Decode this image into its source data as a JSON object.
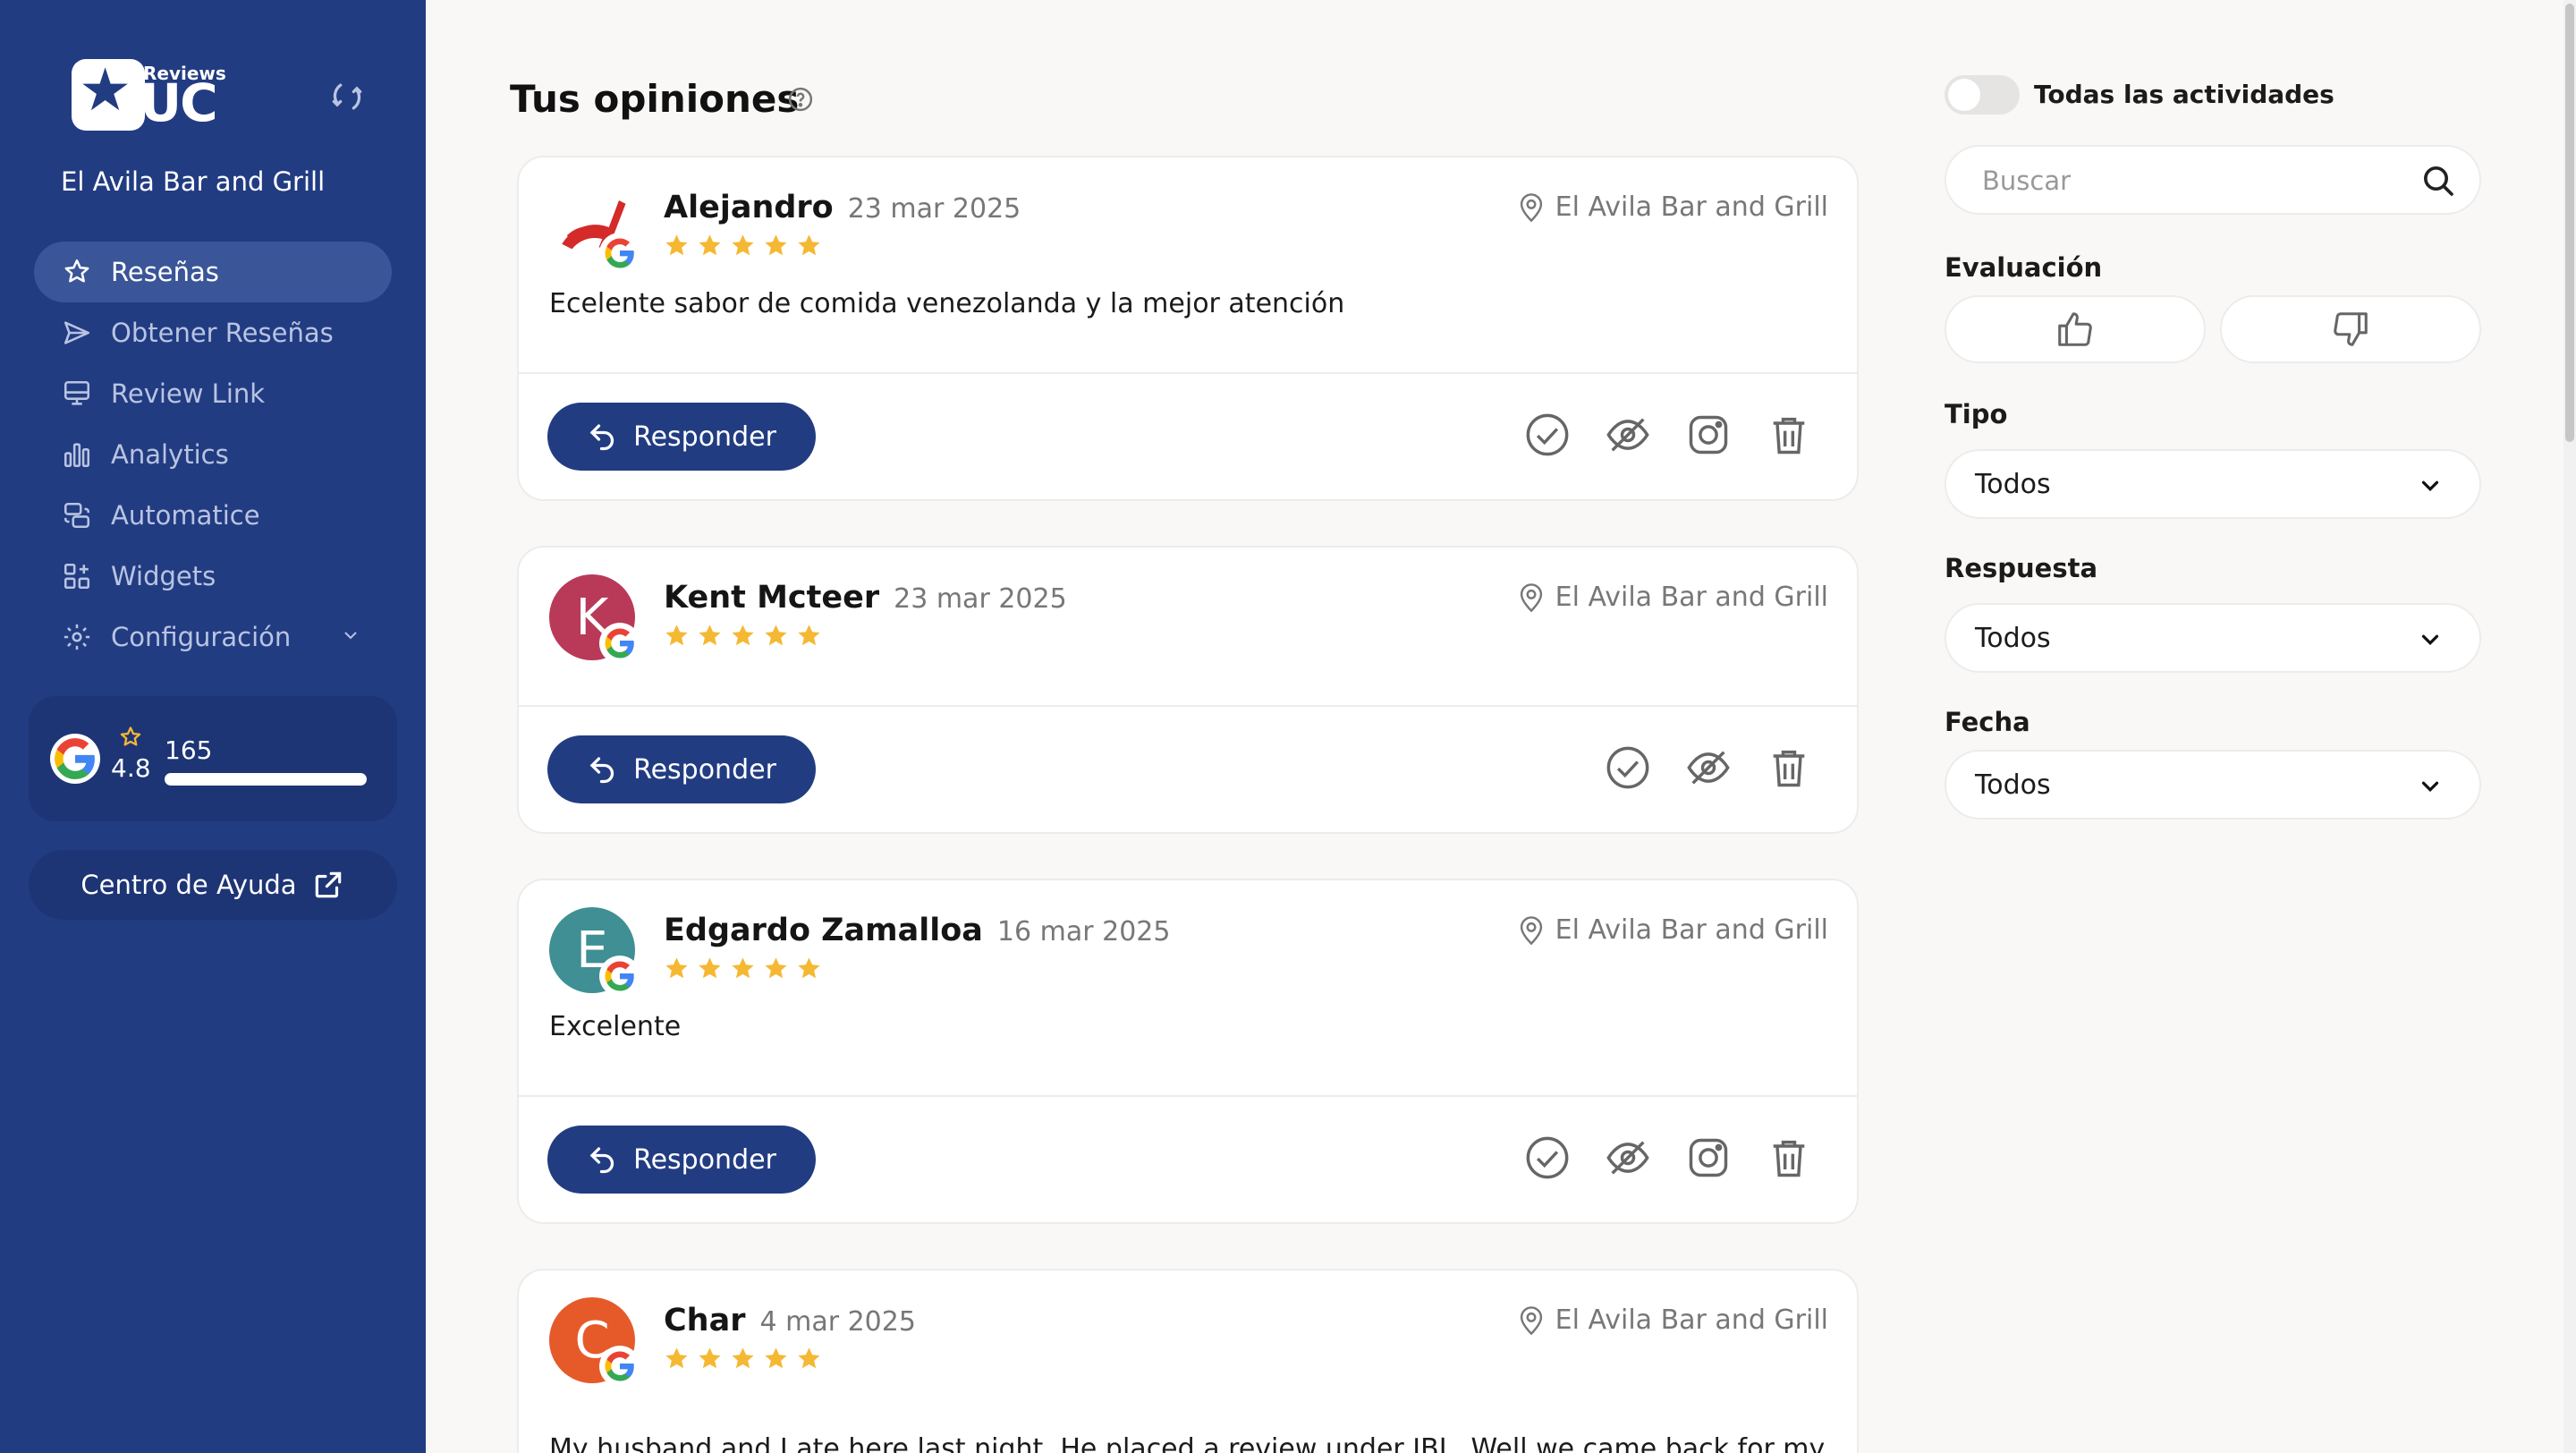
{
  "app": {
    "logo_small": "Reviews",
    "logo_big": "UC",
    "business_name": "El Avila Bar and Grill"
  },
  "nav": [
    {
      "label": "Reseñas",
      "icon": "star-icon",
      "active": true
    },
    {
      "label": "Obtener Reseñas",
      "icon": "send-icon"
    },
    {
      "label": "Review Link",
      "icon": "monitor-icon"
    },
    {
      "label": "Analytics",
      "icon": "bar-chart-icon"
    },
    {
      "label": "Automatice",
      "icon": "automation-icon"
    },
    {
      "label": "Widgets",
      "icon": "widgets-icon"
    },
    {
      "label": "Configuración",
      "icon": "gear-icon"
    }
  ],
  "rating": {
    "score": "4.8",
    "count": "165",
    "progress": 1.0
  },
  "help": {
    "label": "Centro de Ayuda"
  },
  "page": {
    "title": "Tus opiniones"
  },
  "reviews": [
    {
      "name": "Alejandro",
      "date": "23 mar 2025",
      "location": "El Avila Bar and Grill",
      "stars": 5,
      "text": "Ecelente sabor de comida venezolanda y la mejor atención",
      "avatar_letter": "",
      "avatar_color": "#ffffff",
      "reply_label": "Responder"
    },
    {
      "name": "Kent Mcteer",
      "date": "23 mar 2025",
      "location": "El Avila Bar and Grill",
      "stars": 5,
      "text": "",
      "avatar_letter": "K",
      "avatar_color": "#b93a58",
      "reply_label": "Responder"
    },
    {
      "name": "Edgardo Zamalloa",
      "date": "16 mar 2025",
      "location": "El Avila Bar and Grill",
      "stars": 5,
      "text": "Excelente",
      "avatar_letter": "E",
      "avatar_color": "#3f8f94",
      "reply_label": "Responder"
    },
    {
      "name": "Char",
      "date": "4 mar 2025",
      "location": "El Avila Bar and Grill",
      "stars": 5,
      "text": "My husband and I ate here last night. He placed a review under JBL. Well we came back for my",
      "avatar_letter": "C",
      "avatar_color": "#e65a2a",
      "reply_label": "Responder"
    }
  ],
  "filters": {
    "toggle_label": "Todas las actividades",
    "search_placeholder": "Buscar",
    "evaluacion_label": "Evaluación",
    "tipo_label": "Tipo",
    "tipo_value": "Todos",
    "respuesta_label": "Respuesta",
    "respuesta_value": "Todos",
    "fecha_label": "Fecha",
    "fecha_value": "Todos"
  },
  "colors": {
    "sidebar": "#223c82",
    "accent": "#223c82",
    "star": "#f5b833"
  }
}
